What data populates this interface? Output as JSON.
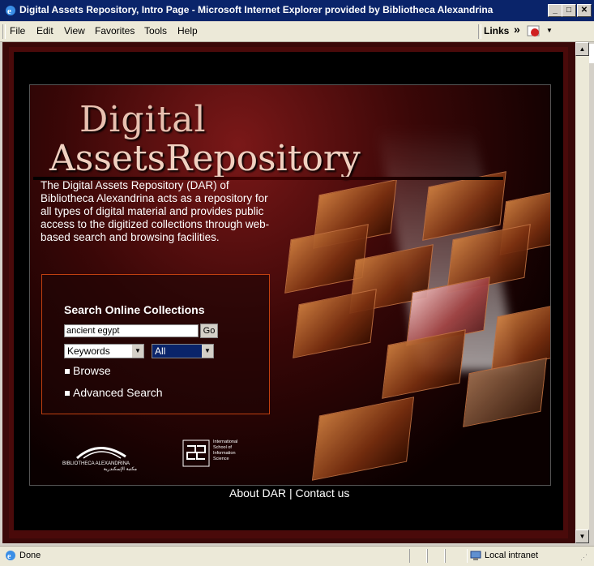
{
  "window": {
    "title": "Digital Assets Repository, Intro Page - Microsoft Internet Explorer provided by Bibliotheca Alexandrina",
    "minimize": "_",
    "maximize": "□",
    "close": "✕"
  },
  "menu": {
    "items": [
      "File",
      "Edit",
      "View",
      "Favorites",
      "Tools",
      "Help"
    ],
    "links_label": "Links",
    "links_chevron": "»"
  },
  "page": {
    "logo_line1": "Digital",
    "logo_line2": "AssetsRepository",
    "description": "The Digital Assets Repository (DAR) of Bibliotheca Alexandrina acts as a repository for all types of digital material and provides public access to the digitized collections through web-based search and browsing facilities.",
    "search_title": "Search Online Collections",
    "search_value": "ancient egypt",
    "go_label": "Go",
    "field_select": "Keywords",
    "scope_select": "All",
    "browse_label": "Browse",
    "advanced_label": "Advanced Search",
    "bib_logo_text": "BIBLIOTHECA ALEXANDRINA",
    "bib_logo_arabic": "مكتبة الإسكندرية",
    "isis_logo_text": "International School of Information Science",
    "footer_about": "About DAR",
    "footer_sep": "|",
    "footer_contact": "Contact us"
  },
  "status": {
    "text": "Done",
    "zone": "Local intranet"
  },
  "colors": {
    "titlebar": "#0a246a",
    "accent_border": "#c04010",
    "page_bg": "#000000"
  }
}
